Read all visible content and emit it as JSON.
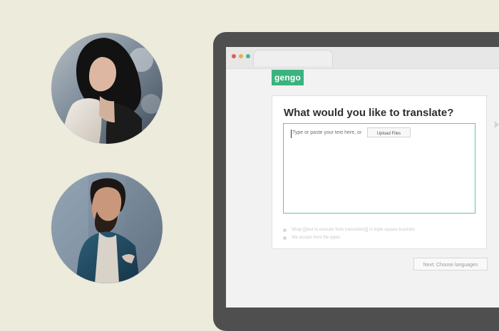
{
  "logo": {
    "text": "gengo"
  },
  "translation_panel": {
    "title": "What would you like to translate?",
    "placeholder_prefix": "Type or paste your text here, or",
    "upload_label": "Upload Files"
  },
  "hints": [
    "Wrap [[[text to exclude from translation]]] in triple square brackets",
    "We accept most file types"
  ],
  "actions": {
    "next_label": "Next: Choose languages"
  },
  "colors": {
    "background": "#ecebdc",
    "accent_green": "#3bb37f",
    "device_frame": "#4f4f4f"
  },
  "icons": [
    "window-close-dot",
    "window-minimize-dot",
    "window-maximize-dot",
    "portrait-1",
    "portrait-2"
  ]
}
